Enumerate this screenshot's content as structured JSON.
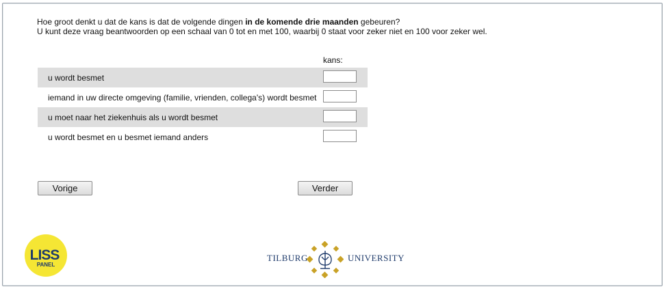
{
  "question": {
    "line1_prefix": "Hoe groot denkt u dat de kans is dat de volgende dingen ",
    "line1_bold": "in de komende drie maanden",
    "line1_suffix": " gebeuren?",
    "line2": "U kunt deze vraag beantwoorden op een schaal van 0 tot en met 100, waarbij 0 staat voor zeker niet en 100 voor zeker wel."
  },
  "grid": {
    "column_header": "kans:",
    "rows": [
      {
        "label": "u wordt besmet",
        "value": ""
      },
      {
        "label": "iemand in uw directe omgeving (familie, vrienden, collega's) wordt besmet",
        "value": ""
      },
      {
        "label": "u moet naar het ziekenhuis als u wordt besmet",
        "value": ""
      },
      {
        "label": "u wordt besmet en u besmet iemand anders",
        "value": ""
      }
    ]
  },
  "buttons": {
    "previous": "Vorige",
    "next": "Verder"
  },
  "logos": {
    "liss_top": "LISS",
    "liss_bottom": "PANEL",
    "tilburg_left": "TILBURG",
    "tilburg_right": "UNIVERSITY"
  },
  "colors": {
    "row_shade": "#dedede",
    "liss_yellow": "#f5e634",
    "tilburg_gold": "#c9a227",
    "tilburg_blue": "#1f3b6b"
  }
}
